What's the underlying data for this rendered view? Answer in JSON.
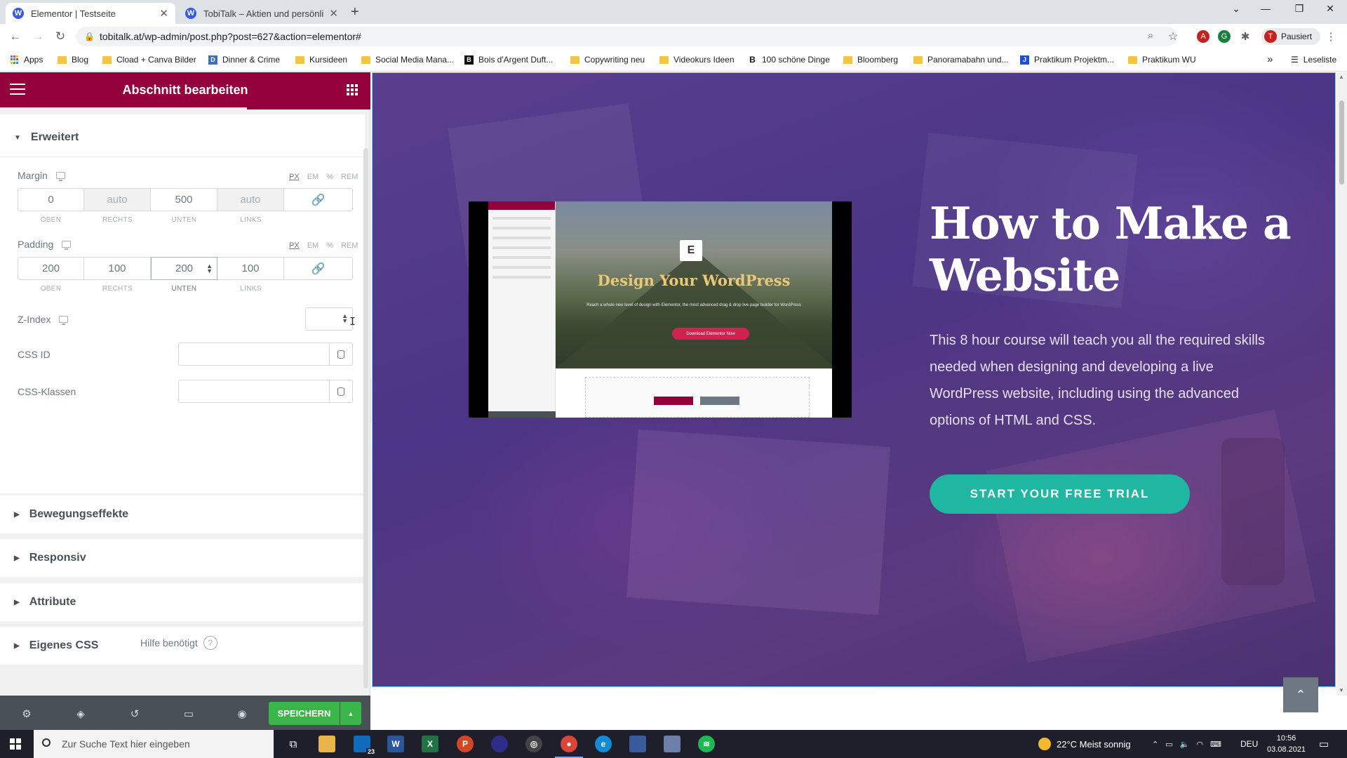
{
  "browser": {
    "tabs": [
      {
        "title": "Elementor | Testseite",
        "active": true
      },
      {
        "title": "TobiTalk – Aktien und persönliche",
        "active": false
      }
    ],
    "new_tab": "+",
    "url": "tobitalk.at/wp-admin/post.php?post=627&action=elementor#",
    "profile_initial": "T",
    "profile_status": "Pausiert",
    "bookmarks": [
      {
        "label": "Apps",
        "icon": "apps-grid-icon"
      },
      {
        "label": "Blog",
        "icon": "folder-icon"
      },
      {
        "label": "Cload + Canva Bilder",
        "icon": "folder-icon"
      },
      {
        "label": "Dinner & Crime",
        "icon": "site-icon"
      },
      {
        "label": "Kursideen",
        "icon": "folder-icon"
      },
      {
        "label": "Social Media Mana...",
        "icon": "folder-icon"
      },
      {
        "label": "Bois d'Argent Duft...",
        "icon": "site-icon"
      },
      {
        "label": "Copywriting neu",
        "icon": "folder-icon"
      },
      {
        "label": "Videokurs Ideen",
        "icon": "folder-icon"
      },
      {
        "label": "100 schöne Dinge",
        "icon": "site-icon"
      },
      {
        "label": "Bloomberg",
        "icon": "folder-icon"
      },
      {
        "label": "Panoramabahn und...",
        "icon": "folder-icon"
      },
      {
        "label": "Praktikum Projektm...",
        "icon": "site-icon"
      },
      {
        "label": "Praktikum WU",
        "icon": "folder-icon"
      }
    ],
    "more_bookmarks": "»",
    "reading_list": "Leseliste"
  },
  "panel": {
    "title": "Abschnitt bearbeiten",
    "advanced_section": "Erweitert",
    "margin": {
      "label": "Margin",
      "units": [
        "PX",
        "EM",
        "%",
        "REM"
      ],
      "values": [
        "0",
        "auto",
        "500",
        "auto"
      ],
      "sides": [
        "OBEN",
        "RECHTS",
        "UNTEN",
        "LINKS"
      ]
    },
    "padding": {
      "label": "Padding",
      "units": [
        "PX",
        "EM",
        "%",
        "REM"
      ],
      "values": [
        "200",
        "100",
        "200",
        "100"
      ],
      "sides": [
        "OBEN",
        "RECHTS",
        "UNTEN",
        "LINKS"
      ]
    },
    "z_index": {
      "label": "Z-Index",
      "value": ""
    },
    "css_id": {
      "label": "CSS ID",
      "value": ""
    },
    "css_classes": {
      "label": "CSS-Klassen",
      "value": ""
    },
    "collapsed_sections": [
      "Bewegungseffekte",
      "Responsiv",
      "Attribute",
      "Eigenes CSS"
    ],
    "help_text": "Hilfe benötigt",
    "save_label": "SPEICHERN"
  },
  "preview": {
    "hero_title": "How to Make a Website",
    "hero_text": "This 8 hour course will teach you all the required skills needed when designing and developing a live WordPress website, including using the advanced options of HTML and CSS.",
    "cta_label": "START YOUR FREE TRIAL",
    "video": {
      "title": "Design Your WordPress",
      "subtitle": "Reach a whole new level of design with Elementor, the most advanced drag & drop live page builder for WordPress",
      "button": "Download Elementor Now"
    }
  },
  "taskbar": {
    "search_placeholder": "Zur Suche Text hier eingeben",
    "mail_badge": "23",
    "weather": "22°C  Meist sonnig",
    "language": "DEU",
    "time": "10:56",
    "date": "03.08.2021"
  },
  "colors": {
    "elementor_brand": "#93003c",
    "cta": "#1fb7a1",
    "save": "#39b54a",
    "hero_overlay": "#4c3586"
  }
}
